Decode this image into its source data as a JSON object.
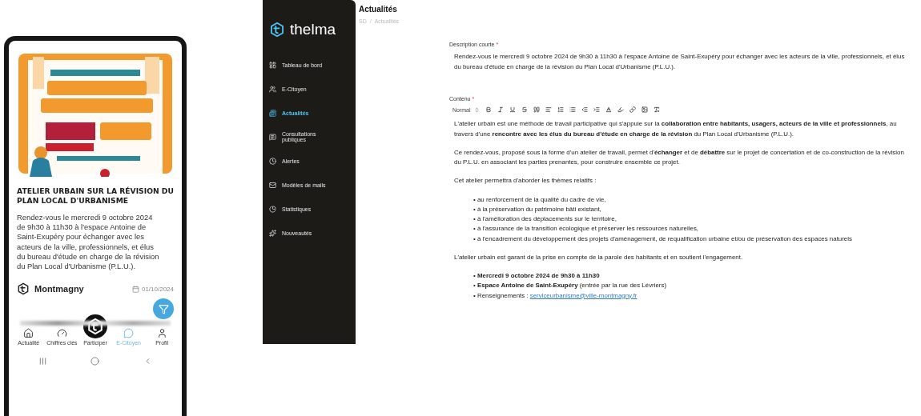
{
  "phone": {
    "title": "ATELIER URBAIN SUR LA RÉVISION DU PLAN LOCAL D'URBANISME",
    "description": "Rendez-vous le mercredi 9 octobre 2024 de 9h30 à 11h30 à l'espace Antoine de Saint-Exupéry pour échanger avec les acteurs de la ville, professionnels, et élus du bureau d'étude en charge de la révision du Plan Local d'Urbanisme (P.L.U.).",
    "author": "Montmagny",
    "date": "01/10/2024",
    "nav": [
      {
        "label": "Actualité",
        "selected": false
      },
      {
        "label": "Chiffres clés",
        "selected": false
      },
      {
        "label": "Participer",
        "selected": false
      },
      {
        "label": "E-Citoyen",
        "selected": true
      },
      {
        "label": "Profil",
        "selected": false
      }
    ]
  },
  "app": {
    "logo": "thelma",
    "sidebar": [
      {
        "label": "Tableau de bord",
        "selected": false
      },
      {
        "label": "E-Citoyen",
        "selected": false
      },
      {
        "label": "Actualités",
        "selected": true
      },
      {
        "label": "Consultations publiques",
        "selected": false
      },
      {
        "label": "Alertes",
        "selected": false
      },
      {
        "label": "Modèles de mails",
        "selected": false
      },
      {
        "label": "Statistiques",
        "selected": false
      },
      {
        "label": "Nouveautés",
        "selected": false
      }
    ],
    "page_title": "Actualités",
    "breadcrumb": [
      "SD",
      "Actualités"
    ],
    "breadcrumb_separator": "/",
    "short_description": {
      "label": "Description courte",
      "mark": "*",
      "value": "Rendez-vous le mercredi 9 octobre 2024 de 9h30 à 11h30 à l'espace Antoine de Saint-Exupéry pour échanger avec les acteurs de la ville, professionnels, et élus du bureau d'étude en charge de la révision du Plan Local d'Urbanisme (P.L.U.)."
    },
    "content": {
      "label": "Contenu",
      "mark": "*",
      "format": "Normal",
      "blocks": [
        {
          "kind": "paragraph",
          "text": "L'atelier urbain est une méthode de travail participative qui s'appuie sur la **collaboration entre habitants, usagers, acteurs de la ville et professionnels**, au travers d'une **rencontre avec les élus du bureau d'étude en charge de la révision** du Plan Local d'Urbanisme (P.L.U.)."
        },
        {
          "kind": "paragraph",
          "text": "Ce rendez-vous, proposé sous la forme d'un atelier de travail, permet d'**échanger** et de **débattre** sur le projet de concertation et de co-construction de la révision du P.L.U. en associant les parties prenantes, pour construire ensemble ce projet."
        },
        {
          "kind": "paragraph",
          "text": "Cet atelier permettra d'aborder les thèmes relatifs :"
        },
        {
          "kind": "list",
          "items": [
            {
              "text": "• au renforcement de la qualité du cadre de vie,"
            },
            {
              "text": "• à la préservation du patrimoine bâti existant,"
            },
            {
              "text": "• à l'amélioration des déplacements sur le territoire,"
            },
            {
              "text": "• à l'assurance de la transition écologique et préserver les ressources naturelles,"
            },
            {
              "text": "• à l'encadrement du développement des projets d'aménagement, de requalification urbaine et/ou de préservation des espaces naturels"
            }
          ]
        },
        {
          "kind": "paragraph",
          "text": "L'atelier urbain est garant de la prise en compte de la parole des habitants et en soutient l'engagement."
        },
        {
          "kind": "list",
          "items": [
            {
              "text": "• **Mercredi 9 octobre 2024 de 9h30 à 11h30**"
            },
            {
              "text": "• **Espace Antoine de Saint-Exupéry** (entrée par la rue des Lévriers)"
            },
            {
              "text": "• Renseignements : ",
              "link": "serviceurbanisme@ville-montmagny.fr"
            }
          ]
        }
      ]
    }
  }
}
